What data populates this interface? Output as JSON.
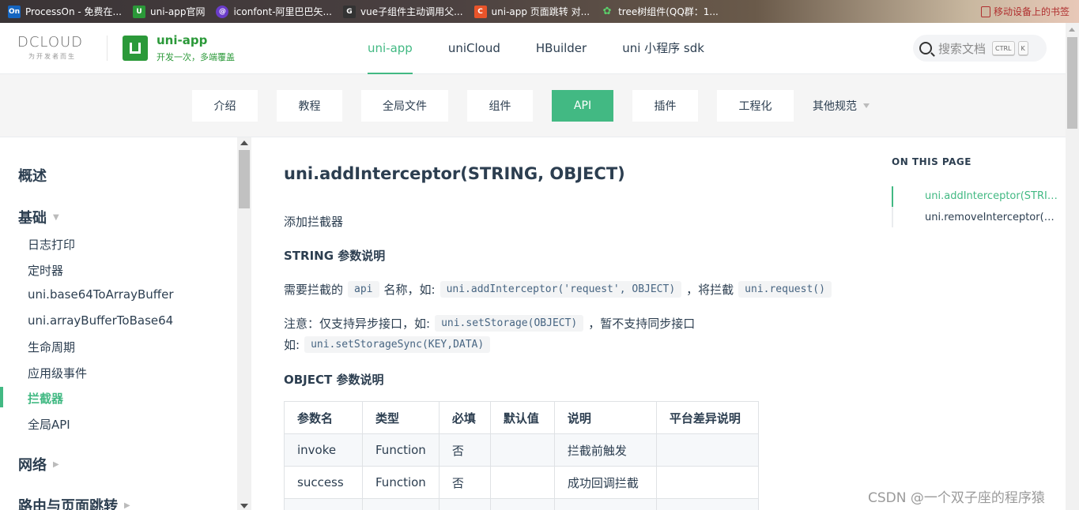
{
  "bookmarks": [
    {
      "label": "ProcessOn - 免费在...",
      "icon": "processon-icon",
      "color": "#1565c0",
      "glyph": "On"
    },
    {
      "label": "uni-app官网",
      "icon": "uniapp-icon",
      "color": "#2b9939",
      "glyph": "U"
    },
    {
      "label": "iconfont-阿里巴巴矢...",
      "icon": "iconfont-icon",
      "color": "#6a3cc9",
      "glyph": "@"
    },
    {
      "label": "vue子组件主动调用父...",
      "icon": "github-icon",
      "color": "#333333",
      "glyph": "G"
    },
    {
      "label": "uni-app 页面跳转 对...",
      "icon": "csdn-icon",
      "color": "#e8542a",
      "glyph": "C"
    },
    {
      "label": "tree树组件(QQ群：1...",
      "icon": "tree-icon",
      "color": "#2b9939",
      "glyph": "✿"
    }
  ],
  "bookmarks_right": "移动设备上的书签",
  "header": {
    "brand_text": "DCLOUD",
    "brand_sub": "为开发者而生",
    "product_title": "uni-app",
    "product_sub": "开发一次，多端覆盖",
    "nav": [
      {
        "label": "uni-app",
        "active": true
      },
      {
        "label": "uniCloud",
        "active": false
      },
      {
        "label": "HBuilder",
        "active": false
      },
      {
        "label": "uni 小程序 sdk",
        "active": false
      }
    ],
    "search_placeholder": "搜索文档",
    "kbd_ctrl": "CTRL",
    "kbd_k": "K"
  },
  "subnav": {
    "tabs": [
      "介绍",
      "教程",
      "全局文件",
      "组件",
      "API",
      "插件",
      "工程化"
    ],
    "active": "API",
    "more": "其他规范"
  },
  "sidebar": {
    "groups": [
      "概述",
      "基础",
      "网络",
      "路由与页面跳转"
    ],
    "items": [
      "日志打印",
      "定时器",
      "uni.base64ToArrayBuffer",
      "uni.arrayBufferToBase64",
      "生命周期",
      "应用级事件",
      "拦截器",
      "全局API"
    ],
    "active_item": "拦截器"
  },
  "main": {
    "title": "uni.addInterceptor(STRING, OBJECT)",
    "desc": "添加拦截器",
    "string_heading": "STRING 参数说明",
    "line1_a": "需要拦截的",
    "line1_code1": "api",
    "line1_b": "名称，如:",
    "line1_code2": "uni.addInterceptor('request', OBJECT)",
    "line1_c": "，将拦截",
    "line1_code3": "uni.request()",
    "line2_a": "注意：仅支持异步接口，如:",
    "line2_code1": "uni.setStorage(OBJECT)",
    "line2_b": "，暂不支持同步接口",
    "line3_a": "如:",
    "line3_code1": "uni.setStorageSync(KEY,DATA)",
    "object_heading": "OBJECT 参数说明",
    "table": {
      "headers": [
        "参数名",
        "类型",
        "必填",
        "默认值",
        "说明",
        "平台差异说明"
      ],
      "rows": [
        [
          "invoke",
          "Function",
          "否",
          "",
          "拦截前触发",
          ""
        ],
        [
          "success",
          "Function",
          "否",
          "",
          "成功回调拦截",
          ""
        ],
        [
          "",
          "",
          "",
          "",
          "",
          ""
        ]
      ]
    }
  },
  "aside": {
    "title": "ON THIS PAGE",
    "links": [
      "uni.addInterceptor(STRIN...",
      "uni.removeInterceptor(ST..."
    ]
  },
  "watermark": "CSDN @一个双子座的程序猿",
  "colors": {
    "accent": "#42b983",
    "brand_green": "#2b9939"
  }
}
